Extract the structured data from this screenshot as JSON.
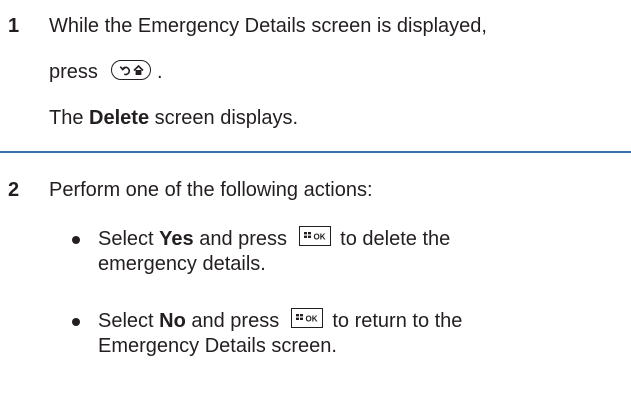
{
  "step1": {
    "number": "1",
    "line1": "While the Emergency Details screen is displayed,",
    "press": "press",
    "period": ".",
    "result_pre": "The ",
    "result_bold": "Delete",
    "result_post": " screen displays.",
    "key_icon": "back-home-key-icon"
  },
  "step2": {
    "number": "2",
    "line1": "Perform one of the following actions:",
    "bullets": [
      {
        "pre": "Select ",
        "bold": "Yes",
        "mid": " and press",
        "post": "to delete the",
        "line2": "emergency details.",
        "key_icon": "menu-ok-key-icon"
      },
      {
        "pre": "Select ",
        "bold": "No",
        "mid": " and press",
        "post": "to return to the",
        "line2": "Emergency Details screen.",
        "key_icon": "menu-ok-key-icon"
      }
    ]
  },
  "colors": {
    "divider": "#3a6ea5",
    "text": "#231f20"
  }
}
